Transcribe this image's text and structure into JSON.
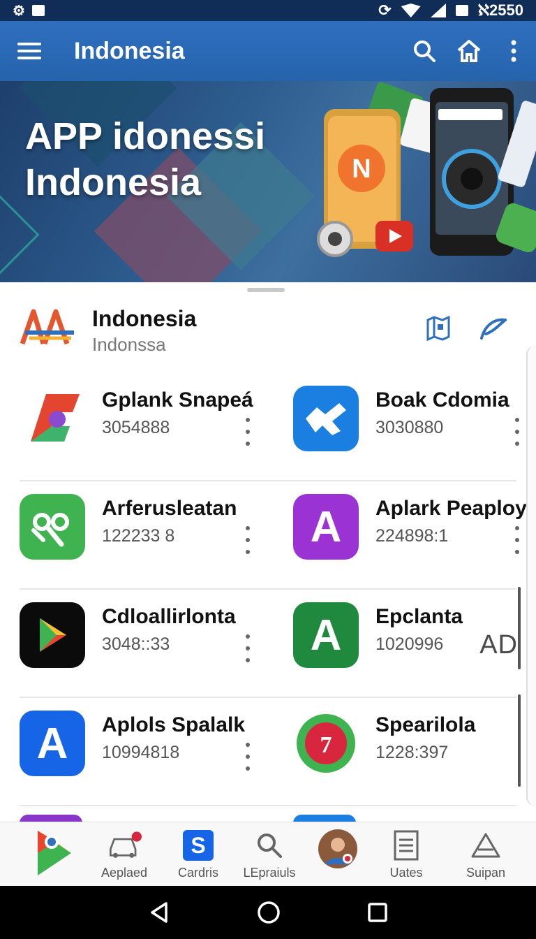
{
  "status_bar": {
    "left_icons": [
      "settings-icon",
      "image-icon"
    ],
    "right_text": "ℵ2550",
    "right_icons": [
      "sync-icon",
      "wifi-icon",
      "signal-icon",
      "battery-icon"
    ]
  },
  "app_bar": {
    "title": "Indonesia",
    "icons": [
      "menu-icon",
      "search-icon",
      "home-icon",
      "more-vert-icon"
    ]
  },
  "banner": {
    "title": "APP idonessi Indonesia"
  },
  "header": {
    "title": "Indonesia",
    "subtitle": "Indonssa",
    "icons": [
      "map-icon",
      "leaf-swoosh-icon"
    ]
  },
  "apps": [
    [
      {
        "name": "Gplank Snapeá",
        "count": "3054888",
        "icon": "g-logo-icon",
        "color": "#e34a3a"
      },
      {
        "name": "Boak Cdomia",
        "count": "3030880",
        "icon": "plane-icon",
        "color": "#1a7fe0"
      }
    ],
    [
      {
        "name": "Arferusleatan",
        "count": "122233 8",
        "icon": "molecule-icon",
        "color": "#3fb34f"
      },
      {
        "name": "Aplark Peaploy",
        "count": "224898:1",
        "icon": "letter-a-icon",
        "color": "#9b32d4"
      }
    ],
    [
      {
        "name": "Cdloallirlonta",
        "count": "3048::33",
        "icon": "play-icon",
        "color": "#0b0b0b"
      },
      {
        "name": "Epclanta",
        "count": "1020996",
        "icon": "letter-a-icon",
        "color": "#1f8a3e"
      }
    ],
    [
      {
        "name": "Aplols Spalalk",
        "count": "10994818",
        "icon": "letter-a-icon",
        "color": "#1565e6"
      },
      {
        "name": "Spearilola",
        "count": "1228:397",
        "icon": "seal-icon",
        "color": "#d7263d"
      }
    ]
  ],
  "ad_label": "AD",
  "bottom_nav": [
    {
      "label": "",
      "icon": "google-play-icon"
    },
    {
      "label": "Aeplaed",
      "icon": "car-icon"
    },
    {
      "label": "Cardris",
      "icon": "s-logo-icon"
    },
    {
      "label": "LEpraiuls",
      "icon": "search-icon"
    },
    {
      "label": "",
      "icon": "avatar-icon"
    },
    {
      "label": "Uates",
      "icon": "document-icon"
    },
    {
      "label": "Suipan",
      "icon": "triangle-a-icon"
    }
  ],
  "colors": {
    "status_bar": "#0f2d57",
    "app_bar": "#2f6fbd",
    "banner_bg": "#1e3f6c"
  }
}
